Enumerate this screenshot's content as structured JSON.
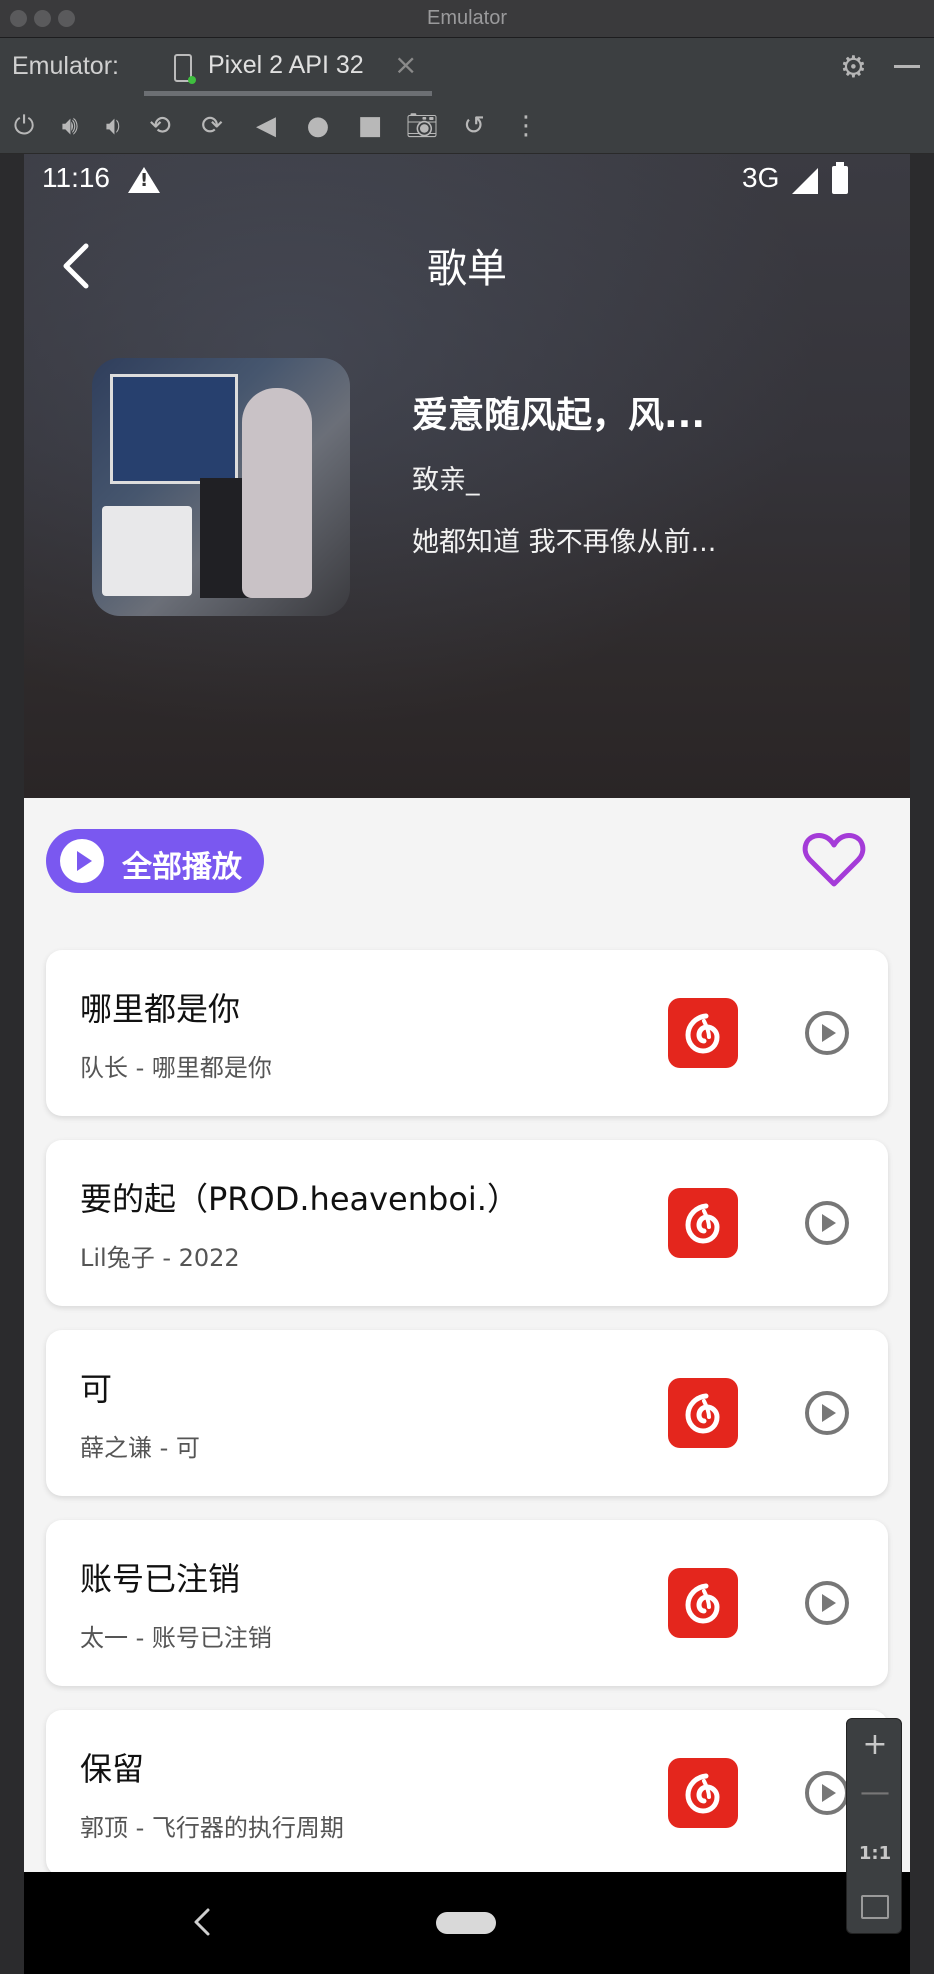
{
  "window": {
    "title": "Emulator"
  },
  "tabbar": {
    "label": "Emulator:",
    "tab_label": "Pixel 2 API 32",
    "tab_close": "×"
  },
  "toolbar": {
    "icons": [
      "power-icon",
      "volume-up-icon",
      "volume-down-icon",
      "rotate-left-icon",
      "rotate-right-icon",
      "back-icon",
      "home-icon",
      "overview-icon",
      "screenshot-icon",
      "snapshot-icon",
      "more-icon"
    ]
  },
  "status_bar": {
    "time": "11:16",
    "network": "3G"
  },
  "header": {
    "title": "歌单"
  },
  "playlist": {
    "title": "爱意随风起，风...",
    "author": "致亲_",
    "description": "她都知道 我不再像从前..."
  },
  "actions": {
    "play_all_label": "全部播放",
    "accent": "#7a58f0",
    "heart_color": "#a43bd8"
  },
  "songs": [
    {
      "name": "哪里都是你",
      "sub": "队长 - 哪里都是你"
    },
    {
      "name": "要的起（PROD.heavenboi.）",
      "sub": "Lil兔子 - 2022"
    },
    {
      "name": "可",
      "sub": "薛之谦 - 可"
    },
    {
      "name": "账号已注销",
      "sub": "太一 - 账号已注销"
    },
    {
      "name": "保留",
      "sub": "郭顶 - 飞行器的执行周期"
    }
  ],
  "netease_color": "#e4261d",
  "zoom_panel": {
    "plus": "+",
    "minus": "—",
    "one_to_one": "1:1"
  }
}
